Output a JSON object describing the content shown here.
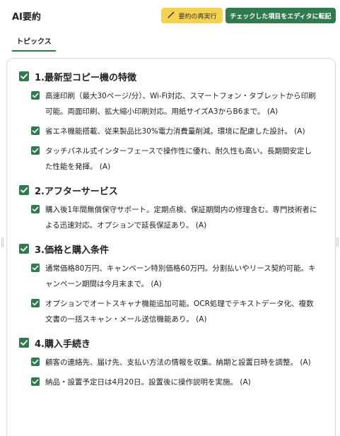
{
  "header": {
    "title": "AI要約",
    "rerun_label": "要約の再実行",
    "transfer_label": "チェックした項目をエディタに転記"
  },
  "tabs": [
    {
      "label": "トピックス",
      "active": true
    }
  ],
  "colors": {
    "accent_green": "#2f7a4f",
    "rerun_yellow": "#f5d24f"
  },
  "icons": {
    "rerun": "magic-wand-icon",
    "check": "checkbox-checked-icon"
  },
  "sections": [
    {
      "title": "1.最新型コピー機の特徴",
      "checked": true,
      "items": [
        {
          "text": "高速印刷（最大30ページ/分）、Wi-Fi対応、スマートフォン・タブレットから印刷可能。両面印刷、拡大縮小印刷対応。用紙サイズA3からB6まで。 (A)",
          "checked": true
        },
        {
          "text": "省エネ機能搭載、従来製品比30%電力消費量削減。環境に配慮した設計。 (A)",
          "checked": true
        },
        {
          "text": "タッチパネル式インターフェースで操作性に優れ、耐久性も高い。長期間安定した性能を発揮。 (A)",
          "checked": true
        }
      ]
    },
    {
      "title": "2.アフターサービス",
      "checked": true,
      "items": [
        {
          "text": "購入後1年間無償保守サポート。定期点検、保証期間内の修理含む。専門技術者による迅速対応。オプションで延長保証あり。 (A)",
          "checked": true
        }
      ]
    },
    {
      "title": "3.価格と購入条件",
      "checked": true,
      "items": [
        {
          "text": "通常価格80万円、キャンペーン特別価格60万円。分割払いやリース契約可能。キャンペーン期間は今月末まで。 (A)",
          "checked": true
        },
        {
          "text": "オプションでオートスキャナ機能追加可能。OCR処理でテキストデータ化、複数文書の一括スキャン・メール送信機能あり。 (A)",
          "checked": true
        }
      ]
    },
    {
      "title": "4.購入手続き",
      "checked": true,
      "items": [
        {
          "text": "顧客の連絡先、届け先、支払い方法の情報を収集。納期と設置日時を調整。 (A)",
          "checked": true
        },
        {
          "text": "納品・設置予定日は4月20日。設置後に操作説明を実施。 (A)",
          "checked": true
        }
      ]
    }
  ]
}
